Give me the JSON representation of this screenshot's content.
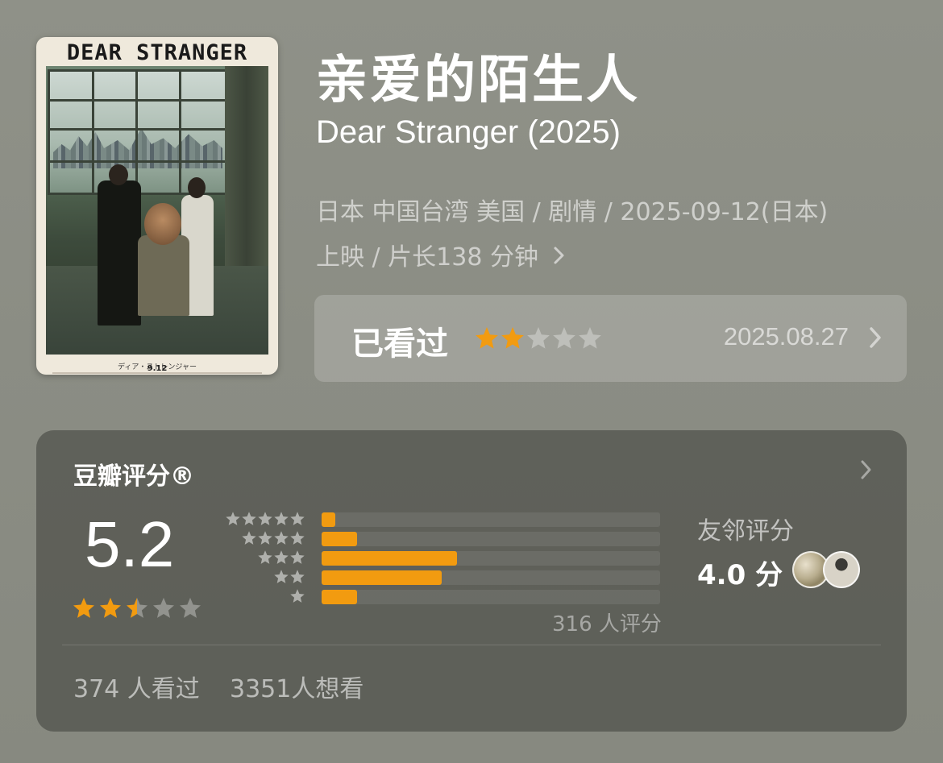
{
  "poster": {
    "title_text": "DEAR STRANGER",
    "date_text": "9.12"
  },
  "title_cn": "亲爱的陌生人",
  "title_en": "Dear Stranger (2025)",
  "meta_line1": "日本 中国台湾 美国 / 剧情 / 2025-09-12(日本)",
  "meta_line2": "上映 / 片长138 分钟",
  "my_rating": {
    "status": "已看过",
    "stars": 2,
    "date": "2025.08.27"
  },
  "douban": {
    "label": "豆瓣评分®",
    "score": "5.2",
    "score_stars": 2.5,
    "distribution": [
      {
        "stars": 5,
        "fraction": 0.04
      },
      {
        "stars": 4,
        "fraction": 0.105
      },
      {
        "stars": 3,
        "fraction": 0.4
      },
      {
        "stars": 2,
        "fraction": 0.355
      },
      {
        "stars": 1,
        "fraction": 0.105
      }
    ],
    "rating_count": "316 人评分",
    "friends_label": "友邻评分",
    "friends_score": "4.0 分",
    "seen": "374 人看过",
    "want": "3351人想看"
  },
  "colors": {
    "star_on": "#f29b10",
    "star_off": "rgba(255,255,255,0.32)",
    "accent": "#f29b10"
  },
  "icons": [
    "chevron-right-icon",
    "star-icon",
    "avatar"
  ]
}
